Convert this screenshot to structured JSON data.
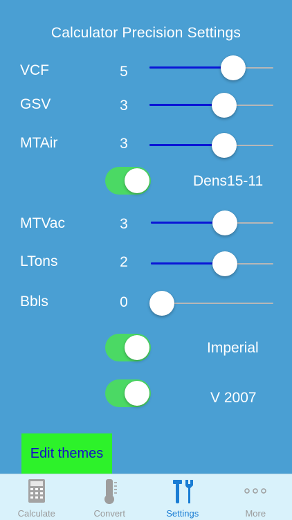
{
  "title": "Calculator Precision Settings",
  "colors": {
    "background": "#4a9fd3",
    "slider_fill": "#0a15d6",
    "toggle_on": "#4bd964",
    "edit_button_bg": "#2df22a",
    "edit_button_text": "#1410c6",
    "tab_active": "#1a7dd4",
    "tab_inactive": "#9a9a9a"
  },
  "settings": [
    {
      "label": "VCF",
      "value": "5",
      "slider_fraction": 0.72
    },
    {
      "label": "GSV",
      "value": "3",
      "slider_fraction": 0.63
    },
    {
      "label": "MTAir",
      "value": "3",
      "slider_fraction": 0.63
    },
    {
      "label": "MTVac",
      "value": "3",
      "slider_fraction": 0.63
    },
    {
      "label": "LTons",
      "value": "2",
      "slider_fraction": 0.63
    },
    {
      "label": "Bbls",
      "value": "0",
      "slider_fraction": 0.0
    }
  ],
  "toggles": [
    {
      "label": "Dens15-11",
      "on": true
    },
    {
      "label": "Imperial",
      "on": true
    },
    {
      "label": "V 2007",
      "on": true
    }
  ],
  "edit_themes_label": "Edit themes",
  "tabbar": {
    "tabs": [
      {
        "label": "Calculate",
        "icon": "calculator-icon",
        "active": false
      },
      {
        "label": "Convert",
        "icon": "thermometer-icon",
        "active": false
      },
      {
        "label": "Settings",
        "icon": "tools-icon",
        "active": true
      },
      {
        "label": "More",
        "icon": "more-dots-icon",
        "active": false
      }
    ]
  }
}
